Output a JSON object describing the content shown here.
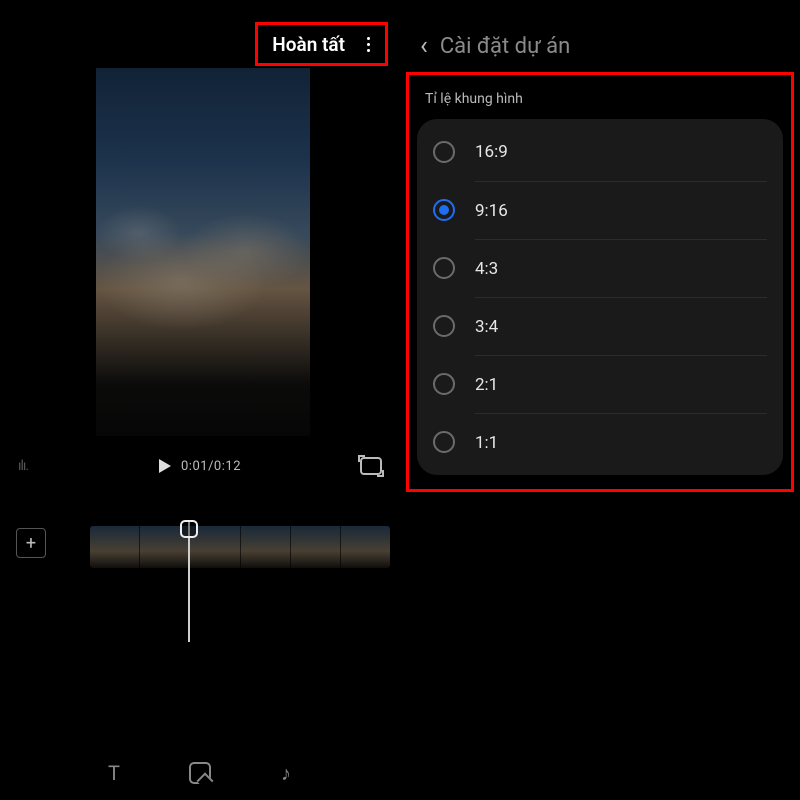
{
  "header": {
    "done_label": "Hoàn tất"
  },
  "preview": {
    "current_time": "0:01",
    "total_time": "0:12",
    "time_display": "0:01/0:12"
  },
  "bottom_tools": {
    "text_icon": "T",
    "sticker_icon": "sticker",
    "music_icon": "♪"
  },
  "settings": {
    "title": "Cài đặt dự án",
    "aspect_ratio": {
      "section_label": "Tỉ lệ khung hình",
      "selected_index": 1,
      "options": [
        {
          "label": "16:9"
        },
        {
          "label": "9:16"
        },
        {
          "label": "4:3"
        },
        {
          "label": "3:4"
        },
        {
          "label": "2:1"
        },
        {
          "label": "1:1"
        }
      ]
    }
  }
}
